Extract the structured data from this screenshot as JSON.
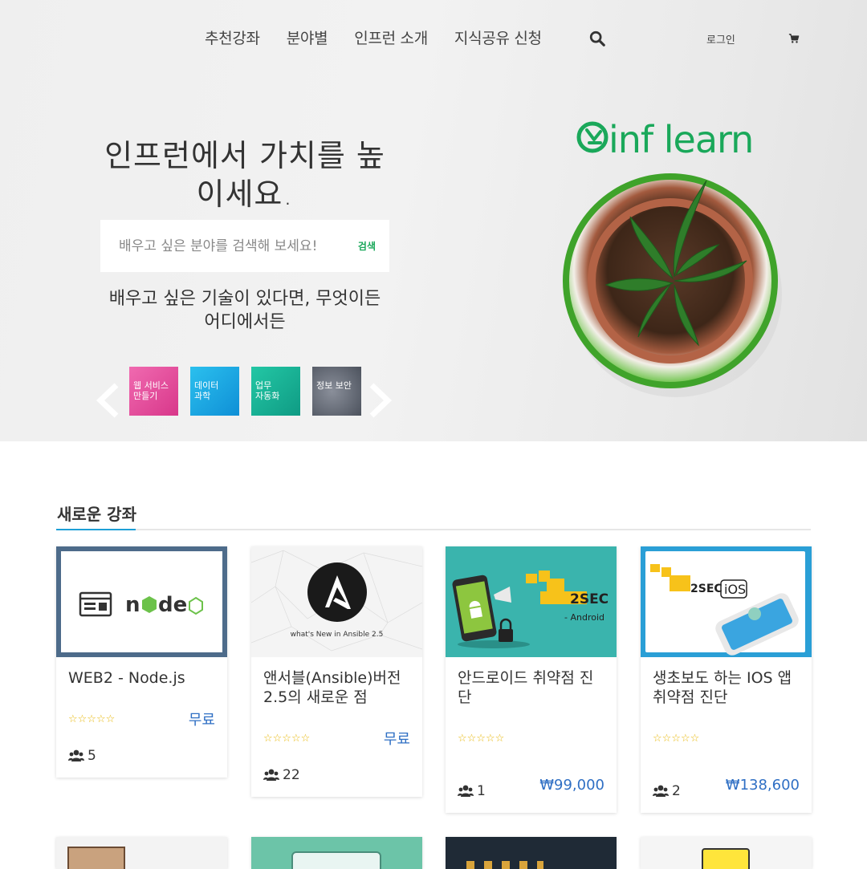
{
  "nav": {
    "items": [
      "추천강좌",
      "분야별",
      "인프런 소개",
      "지식공유 신청"
    ],
    "search_icon": "search-icon",
    "login": "로그인",
    "cart_icon": "cart-icon"
  },
  "hero": {
    "title_line1": "인프런에서 가치를 높",
    "title_line2": "이세요.",
    "search_placeholder": "배우고 싶은 분야를 검색해 보세요!",
    "search_button": "검색",
    "subtitle_line1": "배우고 싶은 기술이 있다면, 무엇이든",
    "subtitle_line2": "어디에서든",
    "categories": [
      {
        "line1": "웹 서비스",
        "line2": "만들기"
      },
      {
        "line1": "데이터",
        "line2": "과학"
      },
      {
        "line1": "업무",
        "line2": "자동화"
      },
      {
        "line1": "정보 보안",
        "line2": ""
      }
    ],
    "logo_text": "inf learn",
    "brand_color": "#1aa85a"
  },
  "section": {
    "title": "새로운 강좌",
    "accent_color": "#1e9fd6"
  },
  "courses": [
    {
      "title_line1": "WEB2 - Node.js",
      "title_line2": "",
      "rating": "☆☆☆☆☆",
      "price": "무료",
      "students": "5",
      "thumb_text": ""
    },
    {
      "title_line1": "앤서블(Ansible)버전",
      "title_line2": "2.5의 새로운 점",
      "rating": "☆☆☆☆☆",
      "price": "무료",
      "students": "22",
      "thumb_text": "what's New in Ansible 2.5"
    },
    {
      "title_line1": "안드로이드 취약점 진",
      "title_line2": "단",
      "rating": "☆☆☆☆☆",
      "price": "₩99,000",
      "students": "1",
      "thumb_text": "2SEC",
      "thumb_sub": "- Android"
    },
    {
      "title_line1": "생초보도 하는 IOS 앱",
      "title_line2": "취약점 진단",
      "rating": "☆☆☆☆☆",
      "price": "₩138,600",
      "students": "2",
      "thumb_text": "2SEC",
      "thumb_sub": "iOS"
    }
  ]
}
